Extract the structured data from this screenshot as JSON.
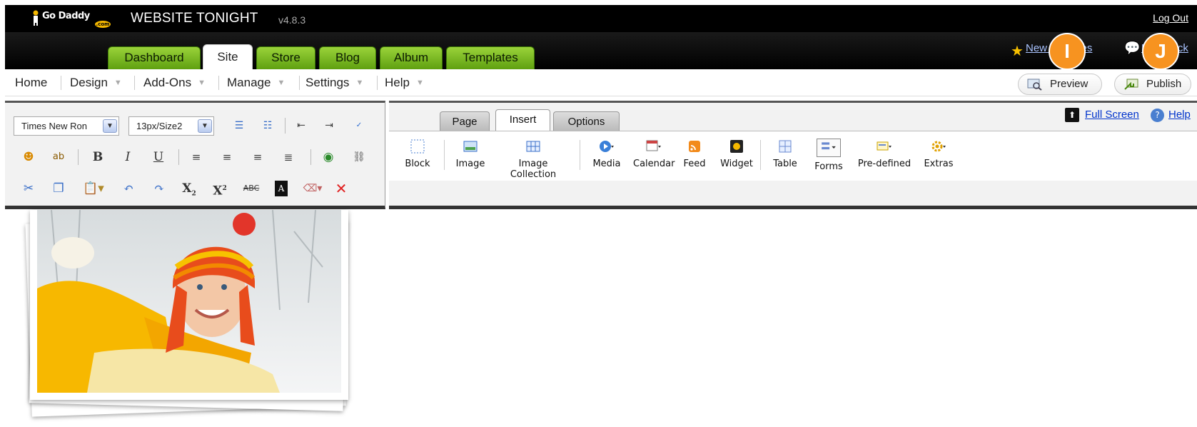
{
  "app": {
    "brand": "Go Daddy",
    "brand_suffix": ".com",
    "title": "WEBSITE TONIGHT",
    "version": "v4.8.3",
    "logout": "Log Out"
  },
  "main_tabs": [
    {
      "label": "Dashboard",
      "active": false
    },
    {
      "label": "Site",
      "active": true
    },
    {
      "label": "Store",
      "active": false
    },
    {
      "label": "Blog",
      "active": false
    },
    {
      "label": "Album",
      "active": false
    },
    {
      "label": "Templates",
      "active": false
    }
  ],
  "top_links": {
    "whats_new": "New Features",
    "feedback": "Feedback"
  },
  "menu": {
    "items": [
      "Home",
      "Design",
      "Add-Ons",
      "Manage",
      "Settings",
      "Help"
    ],
    "preview": "Preview",
    "publish": "Publish"
  },
  "badges": {
    "preview": "I",
    "publish": "J"
  },
  "editor": {
    "font": "Times New Ron",
    "size": "13px/Size2"
  },
  "panel_tabs": [
    {
      "label": "Page",
      "active": false
    },
    {
      "label": "Insert",
      "active": true
    },
    {
      "label": "Options",
      "active": false
    }
  ],
  "panel_links": {
    "fullscreen": "Full Screen",
    "help": "Help"
  },
  "insert_items": [
    "Block",
    "Image",
    "Image Collection",
    "Media",
    "Calendar",
    "Feed",
    "Widget",
    "Table",
    "Forms",
    "Pre-defined",
    "Extras"
  ],
  "colors": {
    "tab_green": "#7dbf24",
    "badge_orange": "#f79320",
    "link_blue": "#0033cc"
  }
}
